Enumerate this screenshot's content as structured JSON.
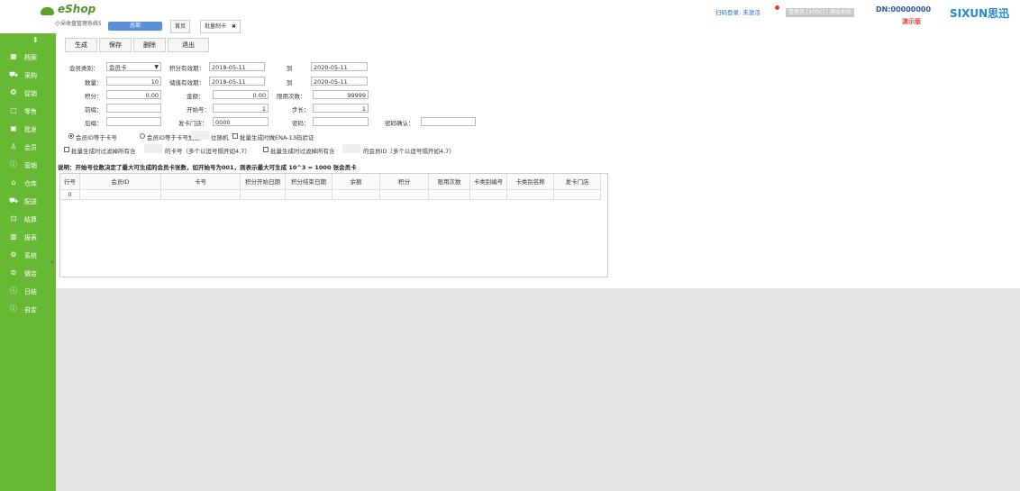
{
  "header": {
    "logo_title": "eShop",
    "logo_sub": "小朵收盘管理系统5",
    "store": "总部",
    "tabs": [
      {
        "label": "首页"
      },
      {
        "label": "批量制卡",
        "close": "✖"
      }
    ],
    "scan_login": "扫码登录: 未激活",
    "user_bar": "管理员 [1001] | 退出系统",
    "dn": "DN:00000000",
    "demo": "演示版",
    "brand": "SIXUN思迅"
  },
  "sidebar": {
    "pin": "⬇",
    "items": [
      {
        "label": "档案",
        "icon": "▦"
      },
      {
        "label": "采购",
        "icon": "⛟"
      },
      {
        "label": "促销",
        "icon": "❂"
      },
      {
        "label": "零售",
        "icon": "▢"
      },
      {
        "label": "批发",
        "icon": "▣"
      },
      {
        "label": "会员",
        "icon": "♙"
      },
      {
        "label": "营销",
        "icon": "ⓘ"
      },
      {
        "label": "仓库",
        "icon": "⌂"
      },
      {
        "label": "配送",
        "icon": "⛟"
      },
      {
        "label": "结算",
        "icon": "⊡"
      },
      {
        "label": "报表",
        "icon": "▥"
      },
      {
        "label": "系统",
        "icon": "⚙"
      },
      {
        "label": "微店",
        "icon": "⊜"
      },
      {
        "label": "日结",
        "icon": "ⓘ"
      },
      {
        "label": "自定",
        "icon": "ⓘ"
      }
    ],
    "collapse": "«"
  },
  "toolbar": {
    "generate": "生成",
    "save": "保存",
    "delete": "删除",
    "exit": "退出"
  },
  "form": {
    "member_type_label": "会员类别：",
    "member_type_value": "会员卡",
    "qty_label": "数量：",
    "qty_value": "10",
    "points_label": "积分：",
    "points_value": "0.00",
    "prefix_label": "前缀：",
    "prefix_value": "",
    "suffix_label": "后缀：",
    "suffix_value": "",
    "pts_valid_label": "积分有效期：",
    "pts_valid_from": "2018-05-11",
    "pts_valid_to_label": "到",
    "pts_valid_to": "2020-05-11",
    "stored_valid_label": "储值有效期：",
    "stored_valid_from": "2018-05-11",
    "stored_valid_to_label": "到",
    "stored_valid_to": "2020-05-11",
    "amount_label": "金额：",
    "amount_value": "0.00",
    "start_no_label": "开始号：",
    "start_no_value": "1",
    "issue_store_label": "发卡门店：",
    "issue_store_value": "0000",
    "limit_label": "限用次数：",
    "limit_value": "99999",
    "step_label": "步长：",
    "step_value": "1",
    "pwd_label": "密码：",
    "pwd_value": "",
    "pwd_confirm_label": "密码确认：",
    "pwd_confirm_value": "",
    "radio1": "会员ID等于卡号",
    "radio2": "会员ID等于卡号加上",
    "random_label": "位随机",
    "ena_label": "批量生成时做ENA-13码验证",
    "filter1a": "批量生成时过滤掉所有含",
    "filter1b": "的卡号（多个以逗号隔开如4,7）",
    "filter2a": "批量生成时过滤掉所有含",
    "filter2b": "的会员ID（多个以逗号隔开如4,7）",
    "note": "说明：开始号位数决定了最大可生成的会员卡张数，如开始号为001，则表示最大可生成 10^3 = 1000 张会员卡"
  },
  "table": {
    "columns": [
      "行号",
      "会员ID",
      "卡号",
      "积分开始日期",
      "积分结束日期",
      "余额",
      "积分",
      "限用次数",
      "卡类别编号",
      "卡类别名称",
      "发卡门店"
    ],
    "rows": [
      [
        "0",
        "",
        "",
        "",
        "",
        "",
        "",
        "",
        "",
        "",
        ""
      ]
    ]
  }
}
